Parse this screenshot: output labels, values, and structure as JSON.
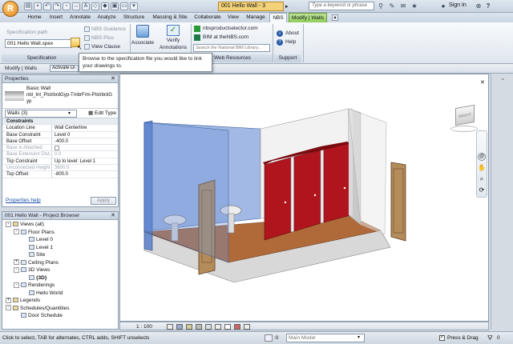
{
  "app": {
    "title": "001 Hello Wall - 3",
    "search_placeholder": "Type a keyword or phrase",
    "sign_in": "Sign In",
    "help": "?"
  },
  "tabs": [
    "Home",
    "Insert",
    "Annotate",
    "Analyze",
    "Structure",
    "Massing & Site",
    "Collaborate",
    "View",
    "Manage",
    "NBS",
    "Modify | Walls"
  ],
  "ribbon": {
    "spec_path_label": "Specification path",
    "spec_path_value": "001 Hello Wall.spex",
    "nbs_guidance": "NBS Guidance",
    "nbs_plus": "NBS Plus",
    "view_clause": "View Clause",
    "associate": "Associate",
    "verify": "Verify",
    "annotations": "Annotations",
    "panel_specification": "Specification",
    "link_product_selector": "nbsproductselector.com",
    "link_bim": "BIM at theNBS.com",
    "bim_search_placeholder": "Search the National BIM Library...",
    "panel_web_resources": "Web Resources",
    "about": "About",
    "help": "Help",
    "panel_support": "Support"
  },
  "tooltip": {
    "text": "Browse to the specification file you would like to link your drawings to."
  },
  "options_bar": {
    "context": "Modify | Walls",
    "activate": "Activate Di"
  },
  "properties": {
    "title": "Properties",
    "type_family": "Basic Wall",
    "type_name": "nbl_Int_PlstrbrdGyp-TmbrFrm-PlstrbrdGyp",
    "selector": "Walls (3)",
    "edit_type": "Edit Type",
    "groups": [
      {
        "name": "Constraints",
        "rows": [
          {
            "k": "Location Line",
            "v": "Wall Centerline",
            "dis": false
          },
          {
            "k": "Base Constraint",
            "v": "Level 0",
            "dis": false
          },
          {
            "k": "Base Offset",
            "v": "-400.0",
            "dis": false
          },
          {
            "k": "Base is Attached",
            "v": "",
            "dis": true
          },
          {
            "k": "Base Extension Dist...",
            "v": "0.0",
            "dis": true
          },
          {
            "k": "Top Constraint",
            "v": "Up to level: Level 1",
            "dis": false
          },
          {
            "k": "Unconnected Height",
            "v": "3600.0",
            "dis": true
          },
          {
            "k": "Top Offset",
            "v": "-800.0",
            "dis": false
          }
        ]
      }
    ],
    "help_link": "Properties help",
    "apply": "Apply"
  },
  "browser": {
    "title": "001 Hello Wall - Project Browser",
    "items": [
      {
        "label": "Views (all)",
        "depth": 0,
        "toggle": "-"
      },
      {
        "label": "Floor Plans",
        "depth": 1,
        "toggle": "-"
      },
      {
        "label": "Level 0",
        "depth": 2,
        "toggle": ""
      },
      {
        "label": "Level 1",
        "depth": 2,
        "toggle": ""
      },
      {
        "label": "Site",
        "depth": 2,
        "toggle": ""
      },
      {
        "label": "Ceiling Plans",
        "depth": 1,
        "toggle": "+"
      },
      {
        "label": "3D Views",
        "depth": 1,
        "toggle": "-"
      },
      {
        "label": "{3D}",
        "depth": 2,
        "toggle": "",
        "bold": true
      },
      {
        "label": "Renderings",
        "depth": 1,
        "toggle": "-"
      },
      {
        "label": "Hello World",
        "depth": 2,
        "toggle": ""
      },
      {
        "label": "Legends",
        "depth": 0,
        "toggle": "+"
      },
      {
        "label": "Schedules/Quantities",
        "depth": 0,
        "toggle": "-"
      },
      {
        "label": "Door Schedule",
        "depth": 1,
        "toggle": ""
      }
    ]
  },
  "viewcube": {
    "label": "RIGHT"
  },
  "view_bar": {
    "scale": "1 : 100"
  },
  "status": {
    "text": "Click to select, TAB for alternates, CTRL adds, SHIFT unselects",
    "zero": ":0",
    "model": "Main Model",
    "press_drag": "Press & Drag",
    "filter": "0"
  },
  "colors": {
    "wall_blue": "#6f93d6",
    "partition_red": "#b0151e",
    "floor_wood": "#b06a3a",
    "ribbon_context": "#8fcc5a"
  }
}
